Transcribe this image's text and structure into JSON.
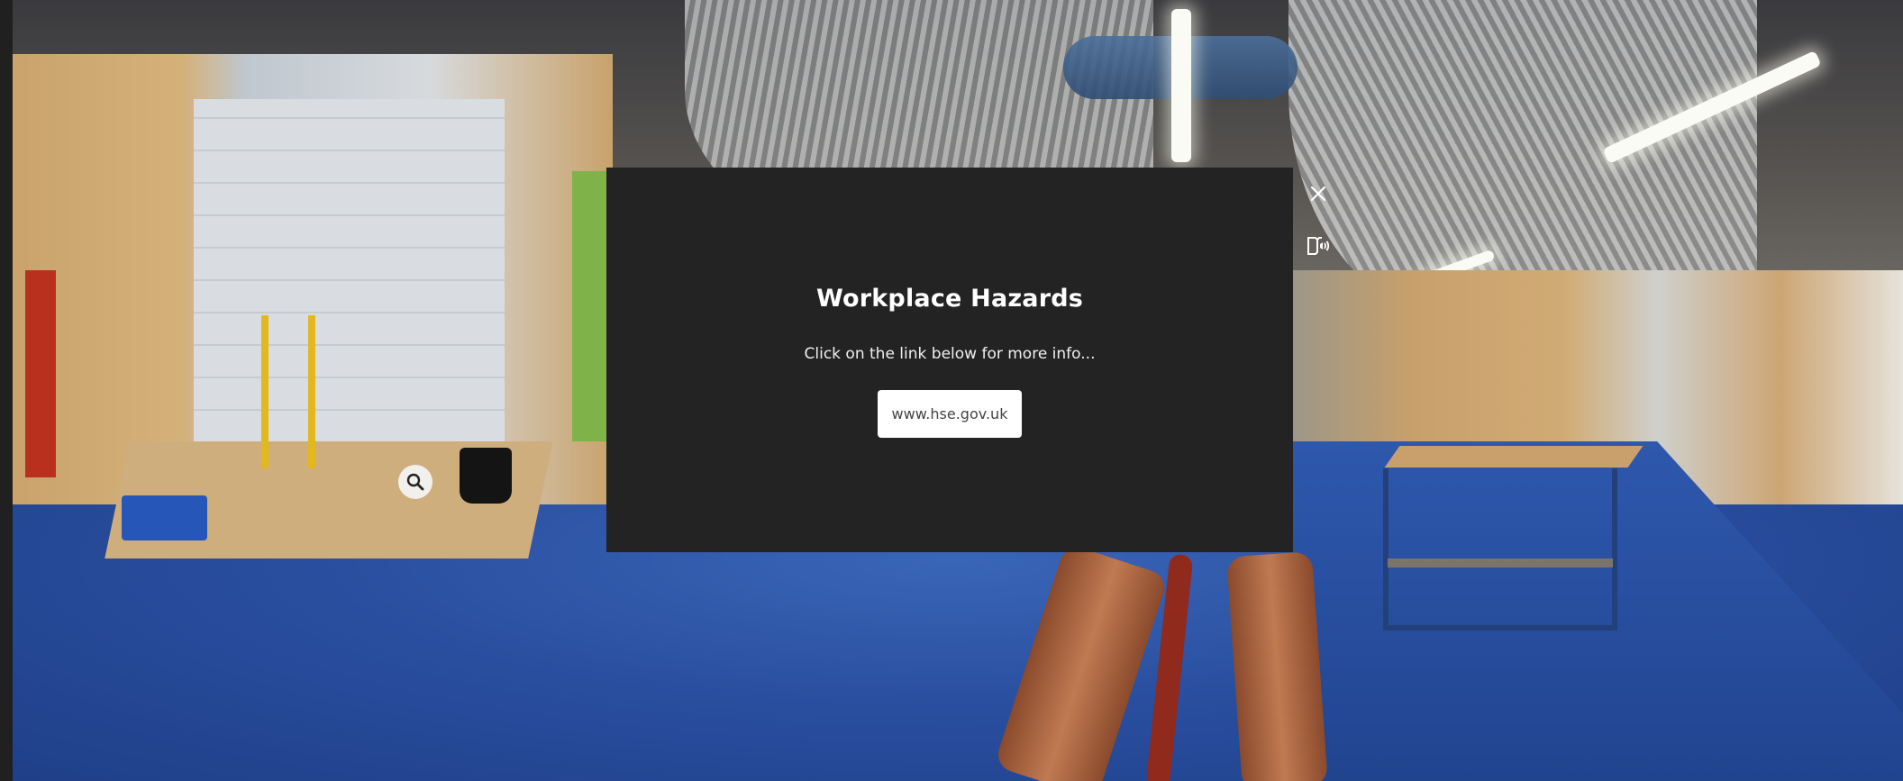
{
  "popup": {
    "title": "Workplace Hazards",
    "message": "Click on the link below for more info...",
    "link_label": "www.hse.gov.uk"
  },
  "controls": {
    "close_icon": "close-icon",
    "audio_icon": "audio-description-icon"
  },
  "hotspot": {
    "icon": "magnifier-icon"
  },
  "colors": {
    "popup_background": "#232323",
    "popup_text": "#ffffff",
    "link_background": "#ffffff",
    "link_text": "#444444",
    "floor_blue": "#2a4fa0"
  }
}
